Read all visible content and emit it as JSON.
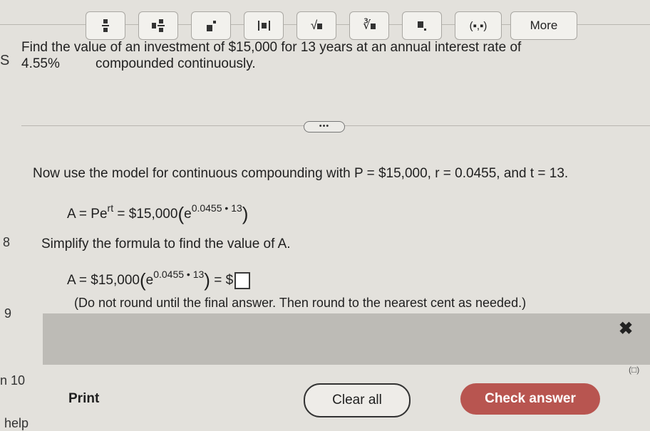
{
  "question": {
    "line1": "Find the value of an investment of $15,000 for 13 years at an annual interest rate of",
    "line2_rate": "4.55%",
    "line2_rest": "compounded continuously."
  },
  "expand_label": "•••",
  "step1": {
    "intro": "Now use the model for continuous compounding with P = $15,000, r = 0.0455, and t = 13.",
    "formula_base": "A = Pe",
    "formula_rt": "rt",
    "formula_eq": " = $15,000",
    "formula_e": "e",
    "formula_exp": "0.0455 • 13"
  },
  "step2": {
    "intro": "Simplify the formula to find the value of A.",
    "formula_lhs": "A = $15,000",
    "formula_e": "e",
    "formula_exp": "0.0455 • 13",
    "formula_eq": " = $",
    "instruction": "(Do not round until the final answer. Then round to the nearest cent as needed.)"
  },
  "left_edge": {
    "s": "S",
    "n8": "8",
    "n9": "9",
    "n10": "n 10",
    "help": "help"
  },
  "toolbar": {
    "buttons": [
      {
        "name": "fraction-button",
        "icon": "fraction-icon"
      },
      {
        "name": "mixed-number-button",
        "icon": "mixed-number-icon"
      },
      {
        "name": "exponent-button",
        "icon": "exponent-icon"
      },
      {
        "name": "absolute-value-button",
        "icon": "absolute-value-icon"
      },
      {
        "name": "square-root-button",
        "icon": "square-root-icon"
      },
      {
        "name": "nth-root-button",
        "icon": "nth-root-icon"
      },
      {
        "name": "subscript-button",
        "icon": "subscript-icon"
      },
      {
        "name": "ordered-pair-button",
        "icon": "ordered-pair-icon"
      }
    ],
    "ordered_pair_label": "(▪,▪)",
    "more_label": "More"
  },
  "actions": {
    "print": "Print",
    "clear_all": "Clear all",
    "check_answer": "Check answer"
  }
}
